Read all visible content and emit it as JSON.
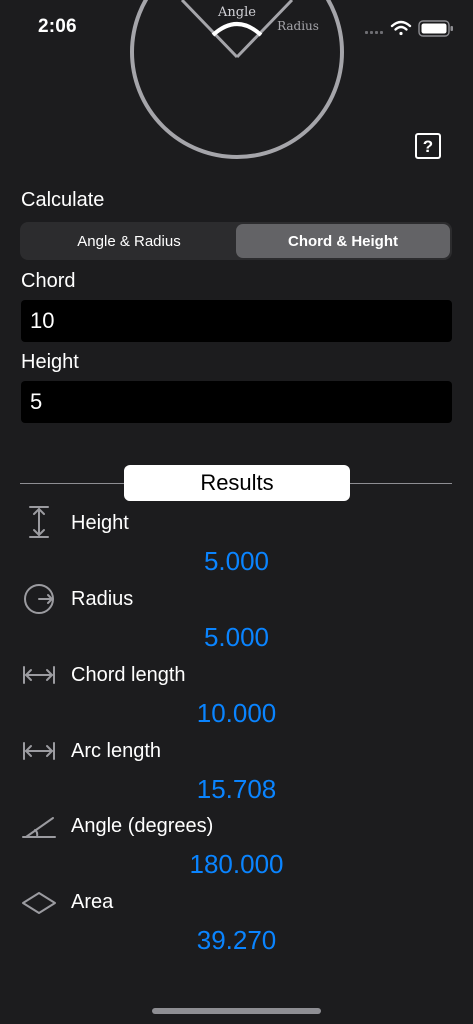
{
  "status": {
    "time": "2:06",
    "icons": [
      "signal-icon",
      "wifi-icon",
      "battery-icon"
    ]
  },
  "diagram": {
    "angle_label": "Angle",
    "radius_label": "Radius"
  },
  "help": {
    "label": "?"
  },
  "calculate": {
    "label": "Calculate",
    "segments": [
      {
        "label": "Angle & Radius",
        "selected": false
      },
      {
        "label": "Chord & Height",
        "selected": true
      }
    ]
  },
  "inputs": {
    "chord": {
      "label": "Chord",
      "value": "10"
    },
    "height": {
      "label": "Height",
      "value": "5"
    }
  },
  "results": {
    "title": "Results",
    "items": [
      {
        "label": "Height",
        "value": "5.000",
        "icon": "vertical-arrows-icon"
      },
      {
        "label": "Radius",
        "value": "5.000",
        "icon": "radius-circle-icon"
      },
      {
        "label": "Chord length",
        "value": "10.000",
        "icon": "horizontal-span-icon"
      },
      {
        "label": "Arc length",
        "value": "15.708",
        "icon": "arc-span-icon"
      },
      {
        "label": "Angle (degrees)",
        "value": "180.000",
        "icon": "angle-icon"
      },
      {
        "label": "Area",
        "value": "39.270",
        "icon": "diamond-area-icon"
      }
    ]
  },
  "colors": {
    "background": "#1c1c1e",
    "accent_value": "#0a84ff",
    "segment_selected": "#636366",
    "segment_bg": "#2c2c2e"
  }
}
